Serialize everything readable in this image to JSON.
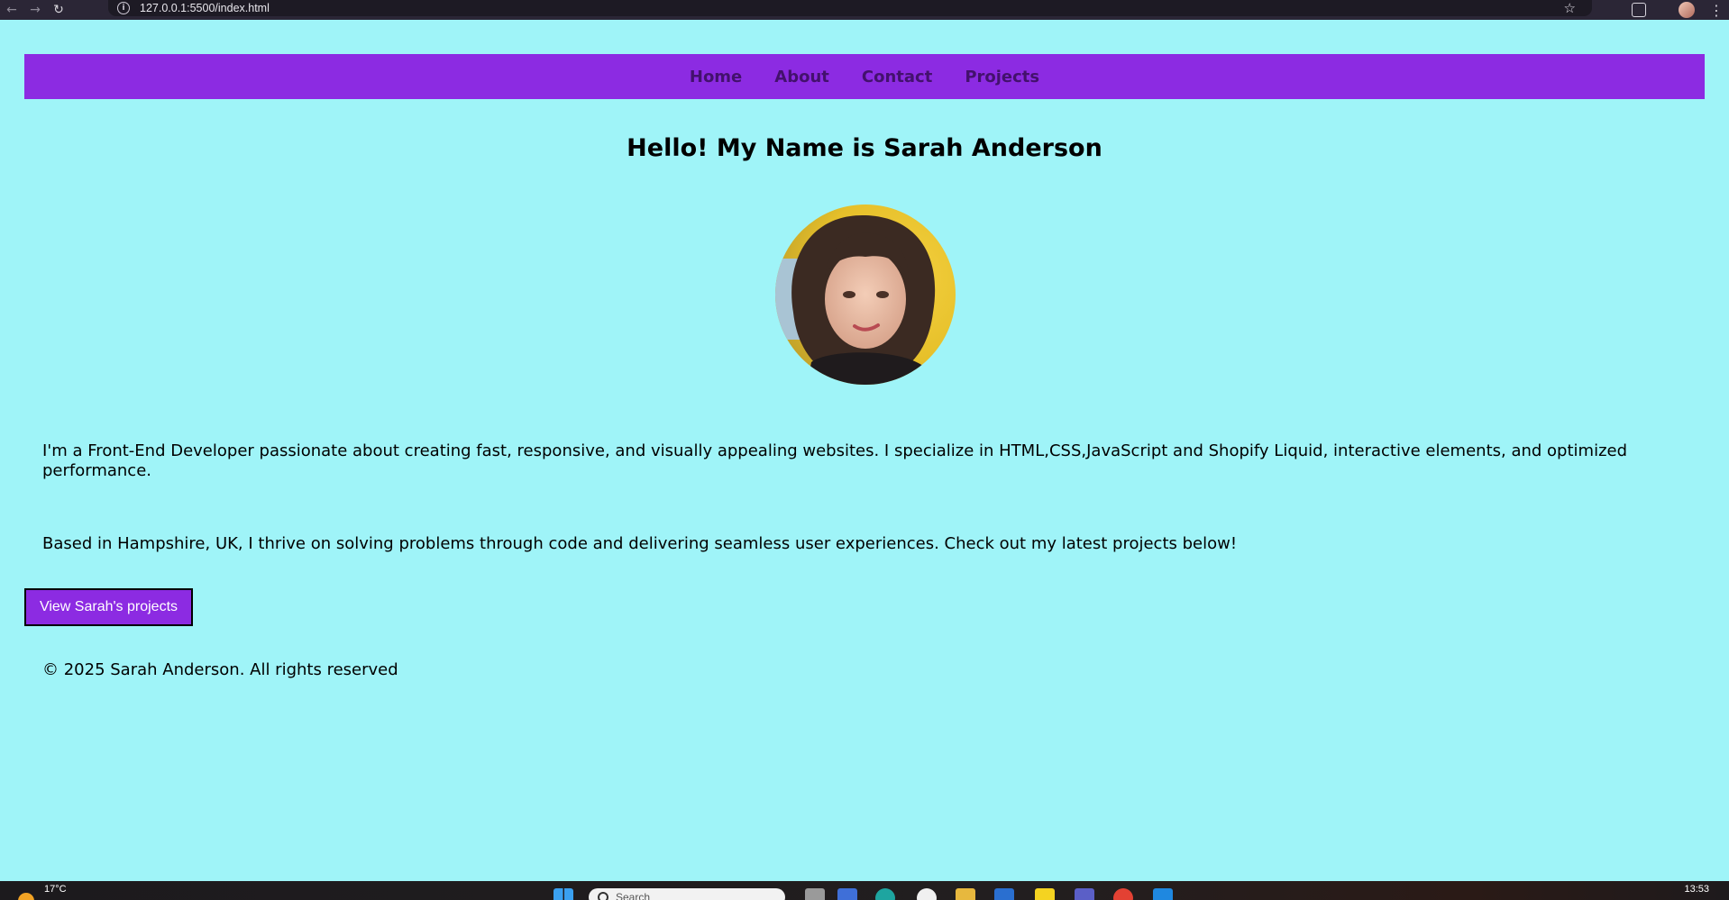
{
  "browser": {
    "url": "127.0.0.1:5500/index.html",
    "back_icon": "arrow-left-icon",
    "forward_icon": "arrow-right-icon",
    "reload_icon": "reload-icon",
    "info_icon": "info-icon",
    "star_icon": "star-icon",
    "extensions_icon": "puzzle-icon",
    "menu_icon": "kebab-menu-icon"
  },
  "nav": {
    "links": [
      "Home",
      "About",
      "Contact",
      "Projects"
    ]
  },
  "hero": {
    "title": "Hello! My Name is Sarah Anderson"
  },
  "about": {
    "paragraph1": "I'm a Front-End Developer passionate about creating fast, responsive, and visually appealing websites. I specialize in HTML,CSS,JavaScript and Shopify Liquid, interactive elements, and optimized performance.",
    "paragraph2": "Based in Hampshire, UK, I thrive on solving problems through code and delivering seamless user experiences. Check out my latest projects below!"
  },
  "cta": {
    "label": "View Sarah's projects"
  },
  "footer": {
    "text": "© 2025 Sarah Anderson. All rights reserved"
  },
  "taskbar": {
    "temperature": "17°C",
    "search_placeholder": "Search",
    "clock": "13:53"
  },
  "colors": {
    "page_background": "#9ff4f8",
    "nav_background": "#8c2be2",
    "nav_link": "#43116d",
    "button_background": "#8c2be2"
  }
}
